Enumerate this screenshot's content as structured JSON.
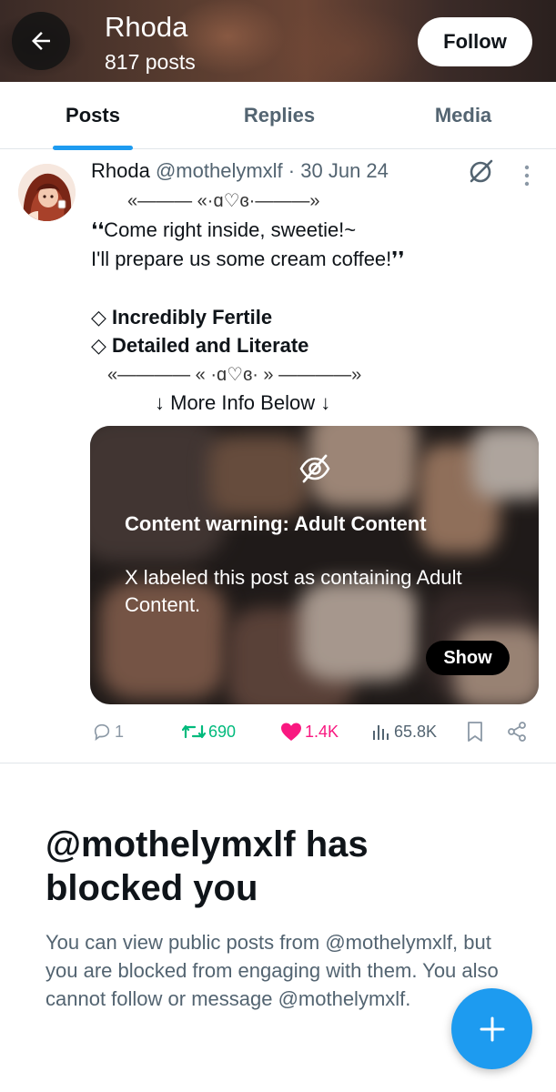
{
  "header": {
    "name": "Rhoda",
    "post_count": "817 posts",
    "follow_label": "Follow",
    "back_icon": "arrow-left-icon"
  },
  "tabs": [
    {
      "label": "Posts",
      "active": true
    },
    {
      "label": "Replies",
      "active": false
    },
    {
      "label": "Media",
      "active": false
    }
  ],
  "post": {
    "author": "Rhoda",
    "handle": "@mothelymxlf",
    "separator": "·",
    "date": "30 Jun 24",
    "lines": [
      "«——— «·ɑ♡ɞ·———»",
      "❛❛Come right inside, sweetie!~",
      "I'll prepare us some cream coffee!❜❜",
      "◇ Incredibly Fertile",
      "◇ Detailed and Literate",
      "«———— « ·ɑ♡ɞ· » ————»",
      "↓ More Info Below ↓"
    ],
    "media": {
      "warning_title": "Content warning: Adult Content",
      "warning_text": "X labeled this post as containing Adult Content.",
      "show_label": "Show",
      "icon": "eye-off-icon"
    },
    "actions": {
      "replies": "1",
      "reposts": "690",
      "likes": "1.4K",
      "views": "65.8K"
    }
  },
  "blocked": {
    "title": "@mothelymxlf has blocked you",
    "body": "You can view public posts from @mothelymxlf, but you are blocked from engaging with them. You also cannot follow or message @mothelymxlf."
  },
  "colors": {
    "accent": "#1d9bf0",
    "repost": "#00ba7c",
    "like": "#f91880",
    "secondary_text": "#536471"
  }
}
